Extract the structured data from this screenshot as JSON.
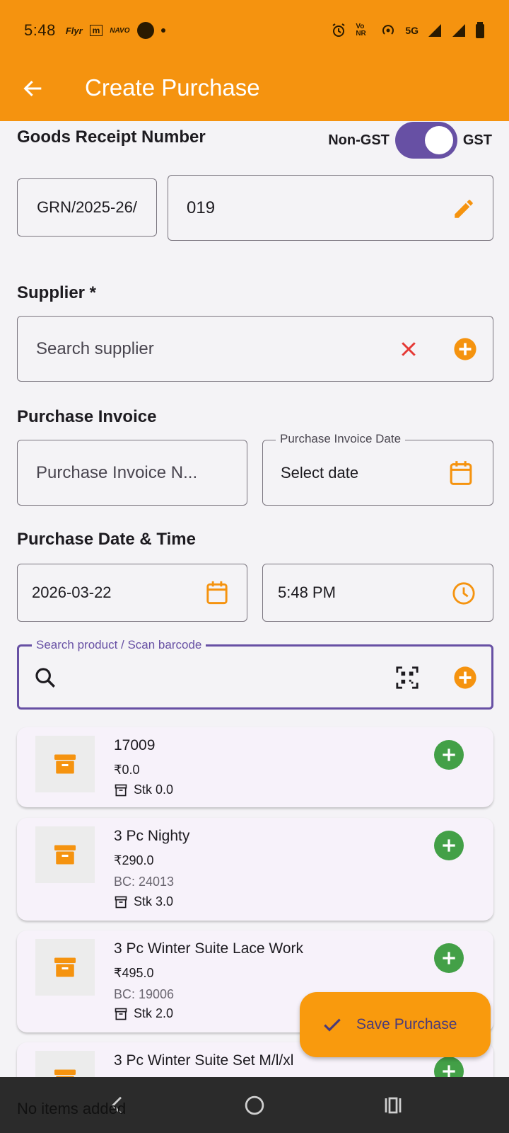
{
  "status_bar": {
    "time": "5:48",
    "app_labels": [
      "Flyr",
      "m",
      "NAVO"
    ],
    "network_label": "5G",
    "volte_label": "Vo NR"
  },
  "app_bar": {
    "title": "Create Purchase"
  },
  "grn": {
    "title": "Goods Receipt Number",
    "toggle_off_label": "Non-GST",
    "toggle_on_label": "GST",
    "toggle_on": true,
    "prefix": "GRN/2025-26/",
    "number": "019"
  },
  "supplier": {
    "title": "Supplier *",
    "placeholder": "Search supplier"
  },
  "invoice": {
    "title": "Purchase Invoice",
    "number_placeholder": "Purchase Invoice N...",
    "date_label": "Purchase Invoice Date",
    "date_value": "Select date"
  },
  "purchase_datetime": {
    "title": "Purchase Date & Time",
    "date": "2026-03-22",
    "time": "5:48 PM"
  },
  "product_search": {
    "label": "Search product / Scan barcode"
  },
  "products": [
    {
      "name": "17009",
      "price": "₹0.0",
      "barcode": "",
      "stock": "Stk 0.0"
    },
    {
      "name": "3 Pc Nighty",
      "price": "₹290.0",
      "barcode": "BC: 24013",
      "stock": "Stk 3.0"
    },
    {
      "name": "3 Pc Winter Suite Lace Work",
      "price": "₹495.0",
      "barcode": "BC: 19006",
      "stock": "Stk 2.0"
    },
    {
      "name": "3 Pc Winter Suite Set M/l/xl",
      "price": "",
      "barcode": "",
      "stock": ""
    }
  ],
  "fab": {
    "label": "Save Purchase"
  },
  "footer": {
    "empty_text": "No items added"
  },
  "colors": {
    "primary_orange": "#f5930f",
    "accent_purple": "#6750a4",
    "add_green": "#43a047",
    "clear_red": "#e53935"
  }
}
